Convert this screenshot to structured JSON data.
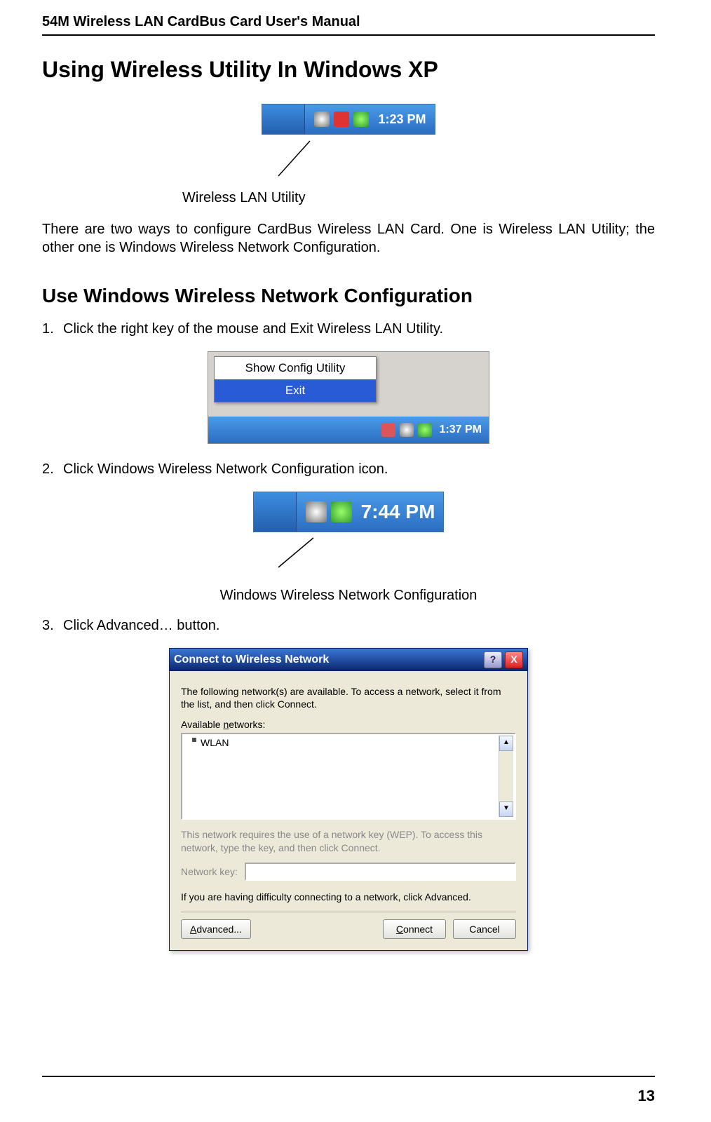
{
  "header": "54M Wireless LAN CardBus Card User's Manual",
  "h1": "Using Wireless Utility In Windows XP",
  "tray1": {
    "time": "1:23 PM"
  },
  "caption1": "Wireless LAN Utility",
  "para1": "There are two ways to configure CardBus Wireless LAN Card. One is Wireless LAN Utility; the other one is Windows Wireless Network Configuration.",
  "h2": "Use Windows Wireless Network Configuration",
  "steps": {
    "s1": {
      "n": "1.",
      "t": "Click the right key of the mouse and Exit Wireless LAN Utility."
    },
    "s2": {
      "n": "2.",
      "t": "Click Windows Wireless Network Configuration icon."
    },
    "s3": {
      "n": "3.",
      "t": "Click Advanced… button."
    }
  },
  "ctx": {
    "item1": "Show Config Utility",
    "item2": "Exit",
    "time": "1:37 PM"
  },
  "tray2": {
    "time": "7:44 PM"
  },
  "caption2": "Windows Wireless Network Configuration",
  "dialog": {
    "title": "Connect to Wireless Network",
    "p1": "The following network(s) are available. To access a network, select it from the list, and then click Connect.",
    "available_label_pre": "Available ",
    "available_label_ul": "n",
    "available_label_post": "etworks:",
    "list_item": "WLAN",
    "wep_note": "This network requires the use of a network key (WEP). To access this network, type the key, and then click Connect.",
    "key_label_pre": "Network ",
    "key_label_ul": "k",
    "key_label_post": "ey:",
    "advice": "If you are having difficulty connecting to a network, click Advanced.",
    "btn_advanced_pre": "",
    "btn_advanced_ul": "A",
    "btn_advanced_post": "dvanced...",
    "btn_connect_pre": "",
    "btn_connect_ul": "C",
    "btn_connect_post": "onnect",
    "btn_cancel": "Cancel",
    "help": "?",
    "close": "X"
  },
  "page_no": "13"
}
